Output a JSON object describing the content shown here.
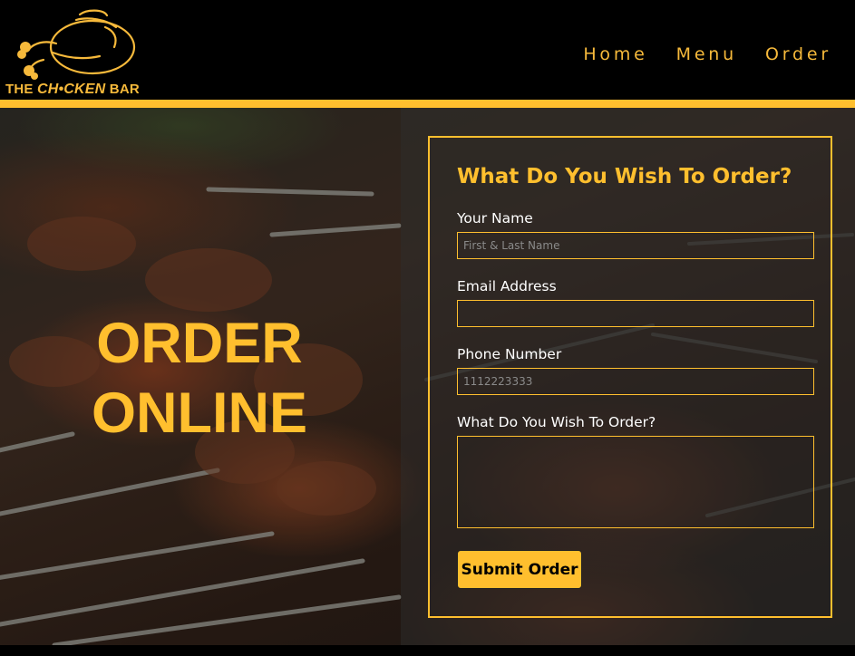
{
  "brand": {
    "logo_prefix": "THE ",
    "logo_mid": "CH•CKEN",
    "logo_suffix": " BAR",
    "color": "#f6b93b"
  },
  "nav": {
    "items": [
      {
        "label": "Home"
      },
      {
        "label": "Menu"
      },
      {
        "label": "Order"
      }
    ]
  },
  "hero": {
    "title_line1": "ORDER",
    "title_line2": "ONLINE"
  },
  "form": {
    "heading": "What Do You Wish To Order?",
    "name_label": "Your Name",
    "name_placeholder": "First & Last Name",
    "email_label": "Email Address",
    "email_placeholder": "",
    "phone_label": "Phone Number",
    "phone_placeholder": "1112223333",
    "order_label": "What Do You Wish To Order?",
    "order_placeholder": "",
    "submit_label": "Submit Order"
  },
  "colors": {
    "accent": "#ffbf2e",
    "background": "#000000",
    "text": "#ffffff"
  },
  "icons": {
    "logo": "chicken-logo-icon"
  }
}
